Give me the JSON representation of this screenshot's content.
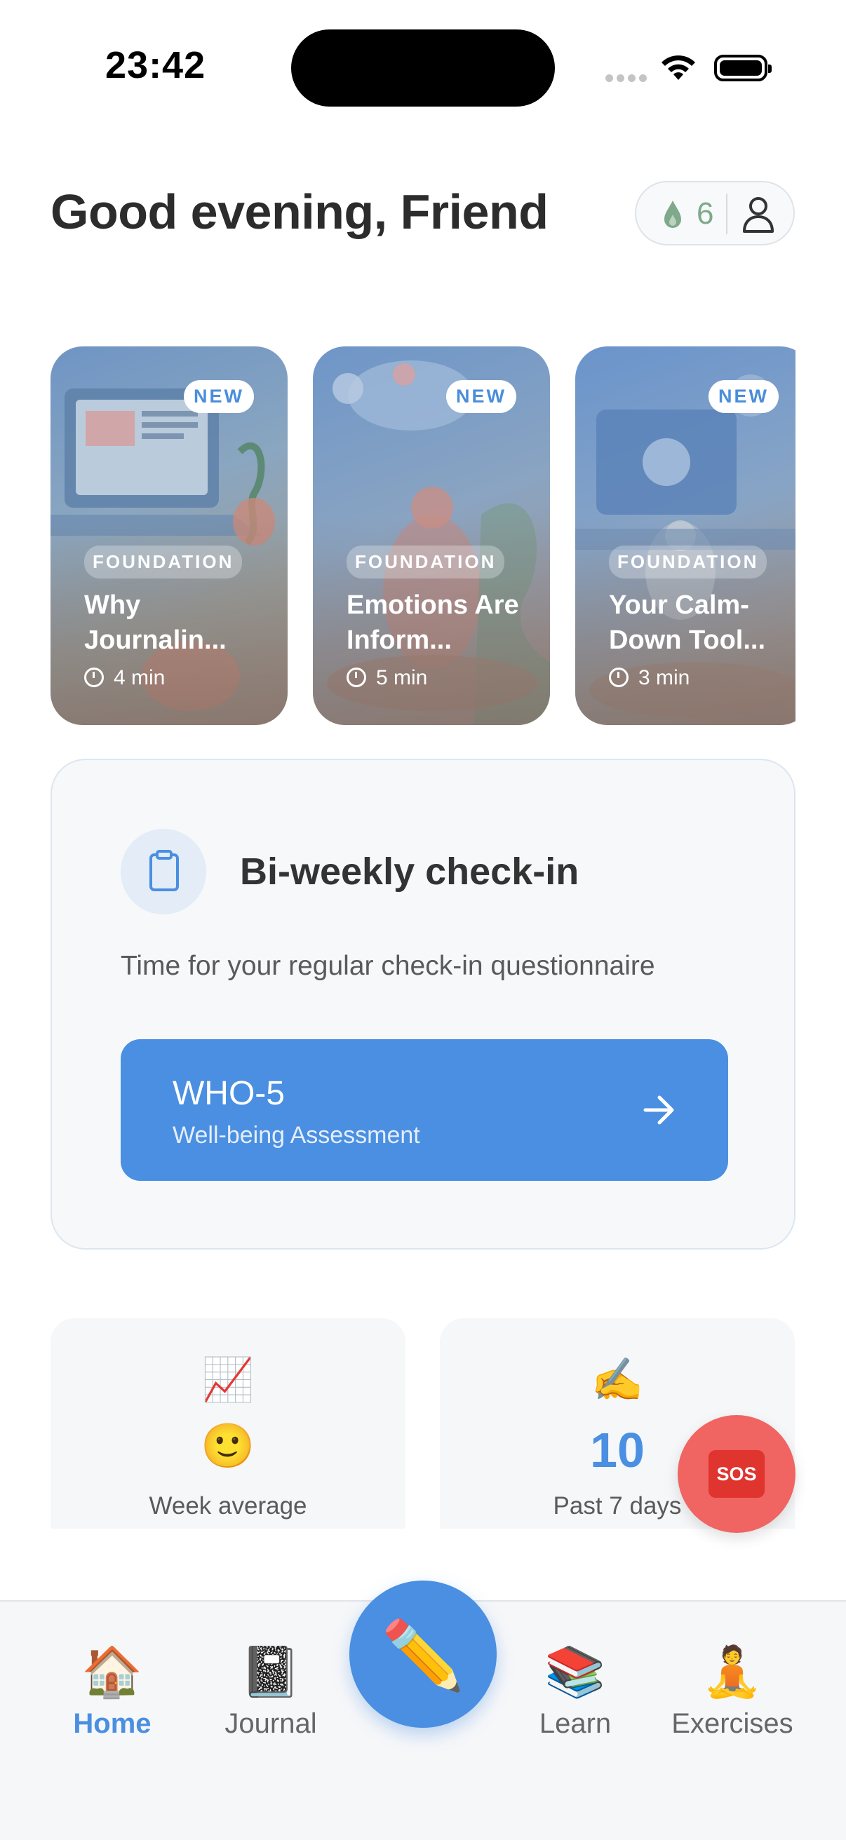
{
  "status_bar": {
    "time": "23:42"
  },
  "header": {
    "greeting": "Good evening, Friend",
    "streak_count": "6",
    "streak_icon": "flame-drop-icon",
    "profile_icon": "person-icon"
  },
  "cards": [
    {
      "badge": "NEW",
      "tag": "FOUNDATION",
      "title": "Why Journalin...",
      "duration": "4 min"
    },
    {
      "badge": "NEW",
      "tag": "FOUNDATION",
      "title": "Emotions Are Inform...",
      "duration": "5 min"
    },
    {
      "badge": "NEW",
      "tag": "FOUNDATION",
      "title": "Your Calm-Down Tool...",
      "duration": "3 min"
    }
  ],
  "checkin": {
    "title": "Bi-weekly check-in",
    "description": "Time for your regular check-in questionnaire",
    "button_title": "WHO-5",
    "button_subtitle": "Well-being Assessment"
  },
  "stats": [
    {
      "icon": "📈",
      "value_emoji": "🙂",
      "label": "Week average"
    },
    {
      "icon": "✍️",
      "value": "10",
      "label": "Past 7 days"
    }
  ],
  "sos_label": "SOS",
  "tabs": [
    {
      "icon": "🏠",
      "label": "Home"
    },
    {
      "icon": "📓",
      "label": "Journal"
    },
    {
      "icon": "📚",
      "label": "Learn"
    },
    {
      "icon": "🧘",
      "label": "Exercises"
    }
  ],
  "fab_icon": "✏️",
  "colors": {
    "accent": "#4a8fe1",
    "sos": "#f06462",
    "streak": "#7fa98a"
  }
}
